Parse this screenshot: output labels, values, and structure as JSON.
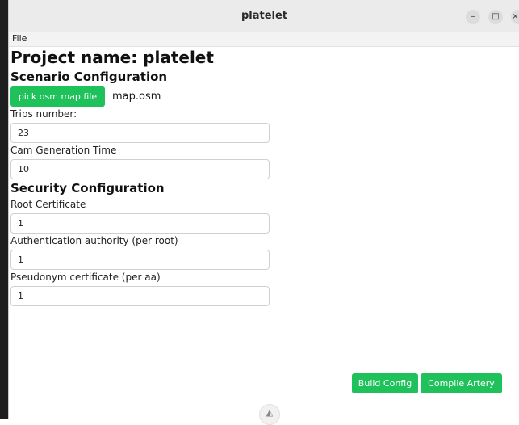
{
  "window": {
    "title": "platelet",
    "minimize_glyph": "–",
    "maximize_glyph": "□",
    "close_glyph": "×"
  },
  "menu": {
    "file": "File"
  },
  "project": {
    "heading": "Project name: platelet"
  },
  "scenario": {
    "heading": "Scenario Configuration",
    "pick_button": "pick osm map file",
    "map_file": "map.osm",
    "trips_label": "Trips number:",
    "trips_value": "23",
    "cam_label": "Cam Generation Time",
    "cam_value": "10"
  },
  "security": {
    "heading": "Security Configuration",
    "root_label": "Root Certificate",
    "root_value": "1",
    "aa_label": "Authentication authority (per root)",
    "aa_value": "1",
    "pseudo_label": "Pseudonym certificate (per aa)",
    "pseudo_value": "1"
  },
  "actions": {
    "build": "Build Config",
    "compile": "Compile Artery"
  },
  "icons": {
    "bottom_logo": "nuxt-triangle-icon",
    "bottom_logo_glyph": "◭"
  },
  "colors": {
    "accent_green": "#1fc15a"
  }
}
